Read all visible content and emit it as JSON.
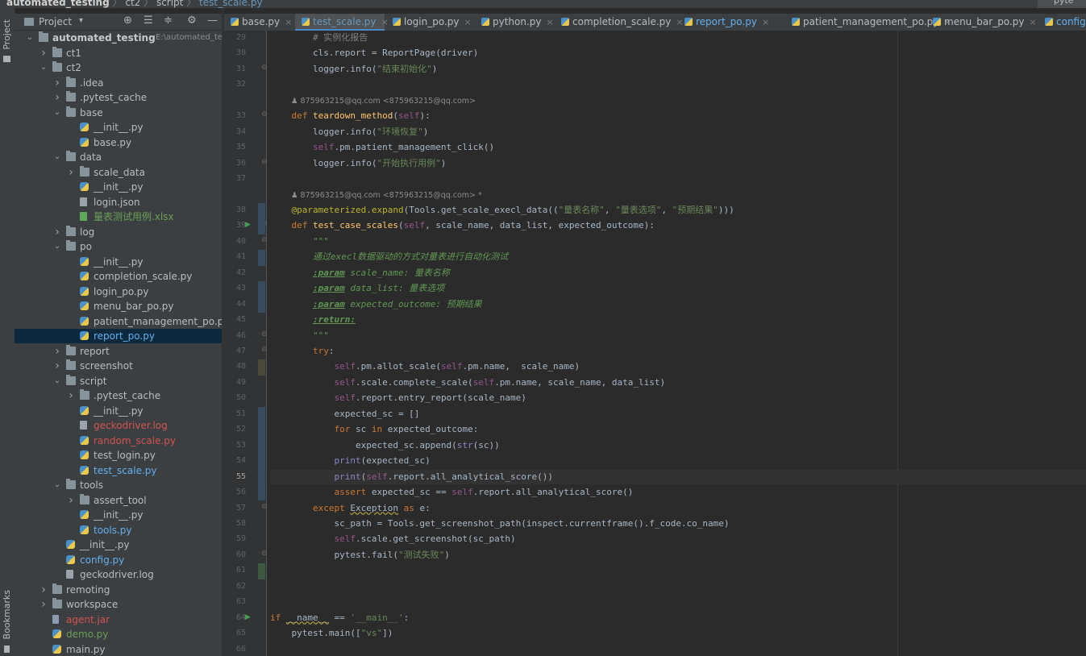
{
  "breadcrumb": {
    "project": "automated_testing",
    "path": [
      "ct2",
      "script",
      "test_scale.py"
    ],
    "right_label": "pyte"
  },
  "side_tabs": {
    "project": "Project",
    "bookmarks": "Bookmarks"
  },
  "project_panel": {
    "title": "Project",
    "toolbar_icons": [
      "target-icon",
      "expand-all-icon",
      "collapse-all-icon",
      "gear-icon",
      "minimize-icon"
    ]
  },
  "tree": [
    {
      "label": "automated_testing",
      "hint": "E:\\automated_testin",
      "type": "folder",
      "arrow": "down",
      "bold": true
    },
    {
      "label": "ct1",
      "type": "folder",
      "arrow": "right"
    },
    {
      "label": "ct2",
      "type": "folder",
      "arrow": "down"
    },
    {
      "label": ".idea",
      "type": "folder",
      "arrow": "right"
    },
    {
      "label": ".pytest_cache",
      "type": "folder",
      "arrow": "right"
    },
    {
      "label": "base",
      "type": "folder",
      "arrow": "down"
    },
    {
      "label": "__init__.py",
      "type": "py"
    },
    {
      "label": "base.py",
      "type": "py"
    },
    {
      "label": "data",
      "type": "folder",
      "arrow": "down"
    },
    {
      "label": "scale_data",
      "type": "folder",
      "arrow": "right"
    },
    {
      "label": "__init__.py",
      "type": "py"
    },
    {
      "label": "login.json",
      "type": "file"
    },
    {
      "label": "量表测试用例.xlsx",
      "type": "xls",
      "color": "green"
    },
    {
      "label": "log",
      "type": "folder",
      "arrow": "right"
    },
    {
      "label": "po",
      "type": "folder",
      "arrow": "down"
    },
    {
      "label": "__init__.py",
      "type": "py"
    },
    {
      "label": "completion_scale.py",
      "type": "py"
    },
    {
      "label": "login_po.py",
      "type": "py"
    },
    {
      "label": "menu_bar_po.py",
      "type": "py"
    },
    {
      "label": "patient_management_po.py",
      "type": "py"
    },
    {
      "label": "report_po.py",
      "type": "py",
      "color": "blue",
      "selected": true
    },
    {
      "label": "report",
      "type": "folder",
      "arrow": "right"
    },
    {
      "label": "screenshot",
      "type": "folder",
      "arrow": "right"
    },
    {
      "label": "script",
      "type": "folder",
      "arrow": "down"
    },
    {
      "label": ".pytest_cache",
      "type": "folder",
      "arrow": "right"
    },
    {
      "label": "__init__.py",
      "type": "py"
    },
    {
      "label": "geckodriver.log",
      "type": "file",
      "color": "red"
    },
    {
      "label": "random_scale.py",
      "type": "py",
      "color": "red"
    },
    {
      "label": "test_login.py",
      "type": "py"
    },
    {
      "label": "test_scale.py",
      "type": "py",
      "color": "blue"
    },
    {
      "label": "tools",
      "type": "folder",
      "arrow": "down"
    },
    {
      "label": "assert_tool",
      "type": "folder",
      "arrow": "right"
    },
    {
      "label": "__init__.py",
      "type": "py"
    },
    {
      "label": "tools.py",
      "type": "py",
      "color": "blue"
    },
    {
      "label": "__init__.py",
      "type": "py"
    },
    {
      "label": "config.py",
      "type": "py",
      "color": "blue"
    },
    {
      "label": "geckodriver.log",
      "type": "file"
    },
    {
      "label": "remoting",
      "type": "folder",
      "arrow": "right"
    },
    {
      "label": "workspace",
      "type": "folder",
      "arrow": "right"
    },
    {
      "label": "agent.jar",
      "type": "jar",
      "color": "red"
    },
    {
      "label": "demo.py",
      "type": "py",
      "color": "green"
    },
    {
      "label": "main.py",
      "type": "py"
    }
  ],
  "tabs": [
    {
      "label": "base.py",
      "active": false
    },
    {
      "label": "test_scale.py",
      "active": true
    },
    {
      "label": "login_po.py",
      "active": false
    },
    {
      "label": "python.py",
      "active": false
    },
    {
      "label": "completion_scale.py",
      "active": false
    },
    {
      "label": "report_po.py",
      "active": false,
      "color": "blue"
    },
    {
      "label": "patient_management_po.py",
      "active": false
    },
    {
      "label": "menu_bar_po.py",
      "active": false
    },
    {
      "label": "config.py",
      "active": false,
      "color": "blue"
    }
  ],
  "editor": {
    "current_line": 55,
    "author_hint_1": "875963215@qq.com <875963215@qq.com>",
    "author_hint_2": "875963215@qq.com <875963215@qq.com> *",
    "lines": [
      {
        "n": 29,
        "text": "        # 实例化报告"
      },
      {
        "n": 30,
        "text": "        cls.report = ReportPage(driver)"
      },
      {
        "n": 31,
        "text": "        logger.info(\"结束初始化\")"
      },
      {
        "n": 32,
        "text": ""
      },
      {
        "n": 33,
        "text": "    def teardown_method(self):"
      },
      {
        "n": 34,
        "text": "        logger.info(\"环境恢复\")"
      },
      {
        "n": 35,
        "text": "        self.pm.patient_management_click()"
      },
      {
        "n": 36,
        "text": "        logger.info(\"开始执行用例\")"
      },
      {
        "n": 37,
        "text": ""
      },
      {
        "n": 38,
        "text": "    @parameterized.expand(Tools.get_scale_execl_data((\"量表名称\", \"量表选项\", \"预期结果\")))"
      },
      {
        "n": 39,
        "text": "    def test_case_scales(self, scale_name, data_list, expected_outcome):"
      },
      {
        "n": 40,
        "text": "        \"\"\""
      },
      {
        "n": 41,
        "text": "        通过execl数据驱动的方式对量表进行自动化测试"
      },
      {
        "n": 42,
        "text": "        :param scale_name: 量表名称"
      },
      {
        "n": 43,
        "text": "        :param data_list: 量表选项"
      },
      {
        "n": 44,
        "text": "        :param expected_outcome: 预期结果"
      },
      {
        "n": 45,
        "text": "        :return:"
      },
      {
        "n": 46,
        "text": "        \"\"\""
      },
      {
        "n": 47,
        "text": "        try:"
      },
      {
        "n": 48,
        "text": "            self.pm.allot_scale(self.pm.name,  scale_name)"
      },
      {
        "n": 49,
        "text": "            self.scale.complete_scale(self.pm.name, scale_name, data_list)"
      },
      {
        "n": 50,
        "text": "            self.report.entry_report(scale_name)"
      },
      {
        "n": 51,
        "text": "            expected_sc = []"
      },
      {
        "n": 52,
        "text": "            for sc in expected_outcome:"
      },
      {
        "n": 53,
        "text": "                expected_sc.append(str(sc))"
      },
      {
        "n": 54,
        "text": "            print(expected_sc)"
      },
      {
        "n": 55,
        "text": "            print(self.report.all_analytical_score())"
      },
      {
        "n": 56,
        "text": "            assert expected_sc == self.report.all_analytical_score()"
      },
      {
        "n": 57,
        "text": "        except Exception as e:"
      },
      {
        "n": 58,
        "text": "            sc_path = Tools.get_screenshot_path(inspect.currentframe().f_code.co_name)"
      },
      {
        "n": 59,
        "text": "            self.scale.get_screenshot(sc_path)"
      },
      {
        "n": 60,
        "text": "            pytest.fail(\"测试失败\")"
      },
      {
        "n": 61,
        "text": ""
      },
      {
        "n": 62,
        "text": ""
      },
      {
        "n": 63,
        "text": ""
      },
      {
        "n": 64,
        "text": "if __name__ == '__main__':"
      },
      {
        "n": 65,
        "text": "    pytest.main([\"vs\"])"
      },
      {
        "n": 66,
        "text": ""
      }
    ]
  },
  "colors": {
    "selected_row": "#0d293e",
    "active_tab_underline": "#4a88c7",
    "keyword": "#cc7832",
    "string": "#6a8759",
    "function": "#ffc66d",
    "self": "#94558d"
  }
}
